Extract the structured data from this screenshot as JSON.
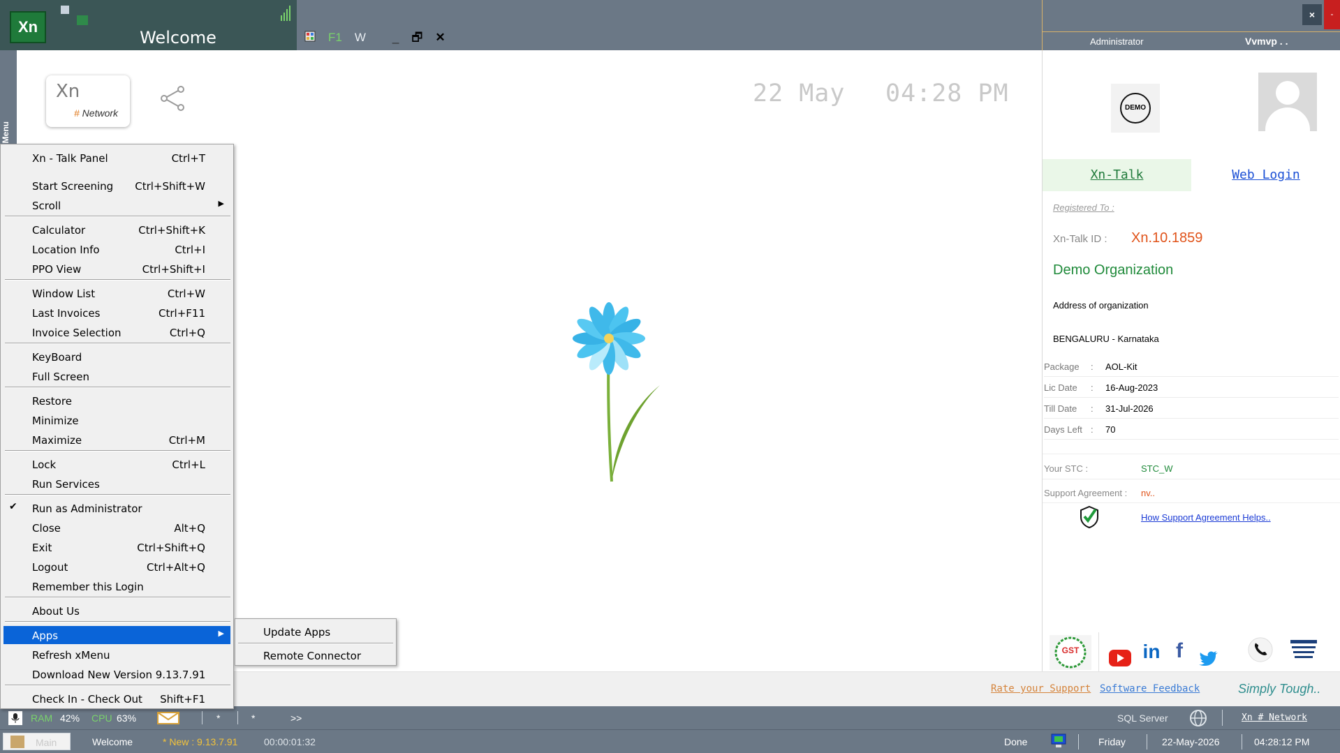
{
  "window": {
    "logo_text": "Xn",
    "welcome_title": "Welcome",
    "toolbar": {
      "f1": "F1",
      "w": "W",
      "min": "_",
      "restore": "🗗",
      "close": "✕"
    },
    "user": {
      "role": "Administrator",
      "name": "Vvmvp . ."
    },
    "top_close": "×",
    "top_min": "-",
    "side_label": "F1 - Menu"
  },
  "main": {
    "network_logo": {
      "xn": "Xn",
      "hash": "#",
      "network": " Network"
    },
    "date": "22 May",
    "time": "04:28 PM"
  },
  "menu": {
    "items": [
      {
        "label": "Xn - Talk Panel",
        "shortcut": "Ctrl+T"
      },
      {
        "label": "Start Screening",
        "shortcut": "Ctrl+Shift+W"
      },
      {
        "label": "Scroll",
        "shortcut": ""
      },
      {
        "label": "Calculator",
        "shortcut": "Ctrl+Shift+K"
      },
      {
        "label": "Location Info",
        "shortcut": "Ctrl+I"
      },
      {
        "label": "PPO View",
        "shortcut": "Ctrl+Shift+I"
      },
      {
        "label": "Window List",
        "shortcut": "Ctrl+W"
      },
      {
        "label": "Last Invoices",
        "shortcut": "Ctrl+F11"
      },
      {
        "label": "Invoice Selection",
        "shortcut": "Ctrl+Q"
      },
      {
        "label": "KeyBoard",
        "shortcut": ""
      },
      {
        "label": "Full Screen",
        "shortcut": ""
      },
      {
        "label": "Restore",
        "shortcut": ""
      },
      {
        "label": "Minimize",
        "shortcut": ""
      },
      {
        "label": "Maximize",
        "shortcut": "Ctrl+M"
      },
      {
        "label": "Lock",
        "shortcut": "Ctrl+L"
      },
      {
        "label": "Run Services",
        "shortcut": ""
      },
      {
        "label": "Run as Administrator",
        "shortcut": "",
        "checked": true
      },
      {
        "label": "Close",
        "shortcut": "Alt+Q"
      },
      {
        "label": "Exit",
        "shortcut": "Ctrl+Shift+Q"
      },
      {
        "label": "Logout",
        "shortcut": "Ctrl+Alt+Q"
      },
      {
        "label": "Remember this Login",
        "shortcut": ""
      },
      {
        "label": "About Us",
        "shortcut": ""
      },
      {
        "label": "Apps",
        "shortcut": "",
        "selected": true
      },
      {
        "label": "Refresh xMenu",
        "shortcut": ""
      },
      {
        "label": "Download New Version 9.13.7.91",
        "shortcut": ""
      },
      {
        "label": "Check In - Check Out",
        "shortcut": "Shift+F1"
      }
    ],
    "submenu": [
      {
        "label": "Update Apps"
      },
      {
        "label": "Remote Connector"
      }
    ],
    "check_glyph": "✔",
    "arrow_glyph": "▶"
  },
  "right_panel": {
    "demo_badge": "DEMO",
    "tabs": {
      "xn_talk": "Xn-Talk",
      "web_login": "Web Login"
    },
    "registered_to": "Registered To :",
    "talk_id_label": "Xn-Talk ID :",
    "talk_id_value": "Xn.10.1859",
    "org_name": "Demo Organization",
    "org_address": "Address of organization",
    "org_city": "BENGALURU - Karnataka",
    "license": [
      {
        "key": "Package",
        "value": "AOL-Kit"
      },
      {
        "key": "Lic Date",
        "value": "16-Aug-2023"
      },
      {
        "key": "Till Date",
        "value": "31-Jul-2026"
      },
      {
        "key": "Days Left",
        "value": "70"
      }
    ],
    "colon": ":",
    "stc_label": "Your STC :",
    "stc_value": "STC_W",
    "support_label": "Support Agreement :",
    "support_value": "nv..",
    "support_link": "How Support Agreement Helps..",
    "social": {
      "gst": "GST",
      "linkedin": "in",
      "facebook": "f"
    }
  },
  "bottom_links": {
    "rate": "Rate your Support",
    "feedback": "Software Feedback",
    "slogan": "Simply Tough.."
  },
  "status_bar": {
    "ram_label": "RAM",
    "ram_value": "42%",
    "cpu_label": "CPU",
    "cpu_value": "63%",
    "star1": "*",
    "star2": "*",
    "more": ">>",
    "sql": "SQL Server",
    "network": "Xn # Network",
    "main_tab": "Main",
    "welcome": "Welcome",
    "new_version": "* New : 9.13.7.91",
    "timer": "00:00:01:32",
    "done": "Done",
    "day": "Friday",
    "date": "22-May-2026",
    "time": "04:28:12 PM"
  },
  "colors": {
    "accent": "#0a64d8",
    "title_bar": "#6b7886",
    "welcome_panel": "#3b5656",
    "org_green": "#1f8a3a",
    "talk_id_orange": "#e0531a"
  }
}
